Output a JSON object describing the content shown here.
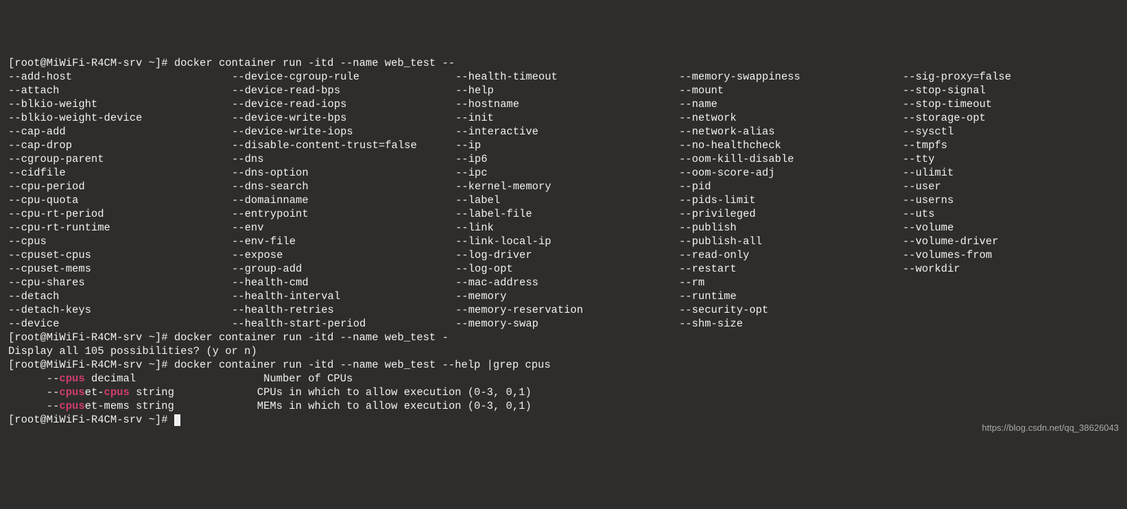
{
  "prompt1": "[root@MiWiFi-R4CM-srv ~]# ",
  "cmd1": "docker container run -itd --name web_test --",
  "options": {
    "col1": [
      "--add-host",
      "--attach",
      "--blkio-weight",
      "--blkio-weight-device",
      "--cap-add",
      "--cap-drop",
      "--cgroup-parent",
      "--cidfile",
      "--cpu-period",
      "--cpu-quota",
      "--cpu-rt-period",
      "--cpu-rt-runtime",
      "--cpus",
      "--cpuset-cpus",
      "--cpuset-mems",
      "--cpu-shares",
      "--detach",
      "--detach-keys",
      "--device"
    ],
    "col2": [
      "--device-cgroup-rule",
      "--device-read-bps",
      "--device-read-iops",
      "--device-write-bps",
      "--device-write-iops",
      "--disable-content-trust=false",
      "--dns",
      "--dns-option",
      "--dns-search",
      "--domainname",
      "--entrypoint",
      "--env",
      "--env-file",
      "--expose",
      "--group-add",
      "--health-cmd",
      "--health-interval",
      "--health-retries",
      "--health-start-period"
    ],
    "col3": [
      "--health-timeout",
      "--help",
      "--hostname",
      "--init",
      "--interactive",
      "--ip",
      "--ip6",
      "--ipc",
      "--kernel-memory",
      "--label",
      "--label-file",
      "--link",
      "--link-local-ip",
      "--log-driver",
      "--log-opt",
      "--mac-address",
      "--memory",
      "--memory-reservation",
      "--memory-swap"
    ],
    "col4": [
      "--memory-swappiness",
      "--mount",
      "--name",
      "--network",
      "--network-alias",
      "--no-healthcheck",
      "--oom-kill-disable",
      "--oom-score-adj",
      "--pid",
      "--pids-limit",
      "--privileged",
      "--publish",
      "--publish-all",
      "--read-only",
      "--restart",
      "--rm",
      "--runtime",
      "--security-opt",
      "--shm-size"
    ],
    "col5": [
      "--sig-proxy=false",
      "--stop-signal",
      "--stop-timeout",
      "--storage-opt",
      "--sysctl",
      "--tmpfs",
      "--tty",
      "--ulimit",
      "--user",
      "--userns",
      "--uts",
      "--volume",
      "--volume-driver",
      "--volumes-from",
      "--workdir"
    ]
  },
  "prompt2": "[root@MiWiFi-R4CM-srv ~]# ",
  "cmd2": "docker container run -itd --name web_test -",
  "display_all": "Display all 105 possibilities? (y or n)",
  "prompt3": "[root@MiWiFi-R4CM-srv ~]# ",
  "cmd3": "docker container run -itd --name web_test --help |grep cpus",
  "help": {
    "l1_pre": "      --",
    "l1_hl1": "cpus",
    "l1_mid": " decimal                    Number of CPUs",
    "l2_pre": "      --",
    "l2_hl1": "cpus",
    "l2_mid1": "et-",
    "l2_hl2": "cpus",
    "l2_mid2": " string             CPUs in which to allow execution (0-3, 0,1)",
    "l3_pre": "      --",
    "l3_hl1": "cpus",
    "l3_mid": "et-mems string             MEMs in which to allow execution (0-3, 0,1)"
  },
  "prompt4": "[root@MiWiFi-R4CM-srv ~]# ",
  "watermark": "https://blog.csdn.net/qq_38626043"
}
